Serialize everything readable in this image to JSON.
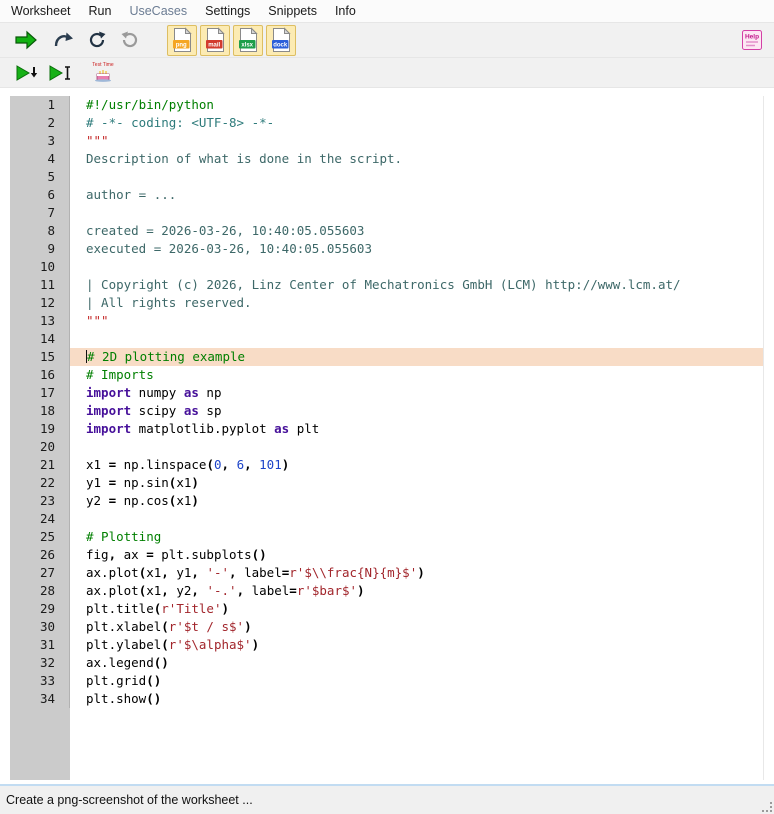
{
  "menu": {
    "items": [
      {
        "label": "Worksheet"
      },
      {
        "label": "Run"
      },
      {
        "label": "UseCases",
        "muted": true
      },
      {
        "label": "Settings"
      },
      {
        "label": "Snippets"
      },
      {
        "label": "Info"
      }
    ]
  },
  "toolbar_main": {
    "export_buttons": [
      {
        "name": "export-png",
        "label": "png",
        "color": "#F5A623"
      },
      {
        "name": "export-mail",
        "label": "mail",
        "color": "#D23B2F"
      },
      {
        "name": "export-xlsx",
        "label": "xlsx",
        "color": "#1E9E4A"
      },
      {
        "name": "export-dock",
        "label": "dock",
        "color": "#2B5FD9"
      }
    ],
    "help_label": "Help"
  },
  "toolbar_run": {
    "test_time_label": "Test Time"
  },
  "icons": {
    "run": "green-arrow-right",
    "run_reload": "curved-arrow",
    "refresh": "circular-arrow-clockwise",
    "undo": "circular-arrow-counterclockwise",
    "help": "help-box",
    "play_down": "play-with-down-arrow",
    "play_bar": "play-with-end-bar",
    "test_time": "birthday-cake",
    "grip": "resize-grip"
  },
  "colors": {
    "syn-comment": "#007F00",
    "syn-coding": "#2E7B7B",
    "syn-docstring": "#3D6868",
    "syn-docquote": "#C42B2B",
    "syn-keyword": "#46109A",
    "syn-number": "#1C43C8",
    "syn-string": "#A2262C",
    "highlight-line": "#F8DCC6",
    "gutter-bg": "#CBCBCB"
  },
  "editor": {
    "lines": [
      {
        "n": 1,
        "segs": [
          {
            "t": "#!/usr/bin/python",
            "c": "com"
          }
        ]
      },
      {
        "n": 2,
        "segs": [
          {
            "t": "# -*- coding: <UTF-8> -*-",
            "c": "cod"
          }
        ]
      },
      {
        "n": 3,
        "segs": [
          {
            "t": "\"\"\"",
            "c": "docq"
          }
        ]
      },
      {
        "n": 4,
        "segs": [
          {
            "t": "Description of what is done in the script.",
            "c": "doc"
          }
        ]
      },
      {
        "n": 5,
        "segs": []
      },
      {
        "n": 6,
        "segs": [
          {
            "t": "author = ...",
            "c": "doc"
          }
        ]
      },
      {
        "n": 7,
        "segs": []
      },
      {
        "n": 8,
        "segs": [
          {
            "t": "created = 2026-03-26, 10:40:05.055603",
            "c": "doc"
          }
        ]
      },
      {
        "n": 9,
        "segs": [
          {
            "t": "executed = 2026-03-26, 10:40:05.055603",
            "c": "doc"
          }
        ]
      },
      {
        "n": 10,
        "segs": []
      },
      {
        "n": 11,
        "segs": [
          {
            "t": "| Copyright (c) 2026, Linz Center of Mechatronics GmbH (LCM) http://www.lcm.at/",
            "c": "doc"
          }
        ]
      },
      {
        "n": 12,
        "segs": [
          {
            "t": "| All rights reserved.",
            "c": "doc"
          }
        ]
      },
      {
        "n": 13,
        "segs": [
          {
            "t": "\"\"\"",
            "c": "docq"
          }
        ]
      },
      {
        "n": 14,
        "segs": []
      },
      {
        "n": 15,
        "hl": true,
        "caret": true,
        "segs": [
          {
            "t": "# 2D plotting example",
            "c": "com"
          }
        ]
      },
      {
        "n": 16,
        "segs": [
          {
            "t": "# Imports",
            "c": "com"
          }
        ]
      },
      {
        "n": 17,
        "segs": [
          {
            "t": "import",
            "c": "kw"
          },
          {
            "t": " numpy ",
            "c": "pln"
          },
          {
            "t": "as",
            "c": "kw"
          },
          {
            "t": " np",
            "c": "pln"
          }
        ]
      },
      {
        "n": 18,
        "segs": [
          {
            "t": "import",
            "c": "kw"
          },
          {
            "t": " scipy ",
            "c": "pln"
          },
          {
            "t": "as",
            "c": "kw"
          },
          {
            "t": " sp",
            "c": "pln"
          }
        ]
      },
      {
        "n": 19,
        "segs": [
          {
            "t": "import",
            "c": "kw"
          },
          {
            "t": " matplotlib.pyplot ",
            "c": "pln"
          },
          {
            "t": "as",
            "c": "kw"
          },
          {
            "t": " plt",
            "c": "pln"
          }
        ]
      },
      {
        "n": 20,
        "segs": []
      },
      {
        "n": 21,
        "segs": [
          {
            "t": "x1 ",
            "c": "pln"
          },
          {
            "t": "= ",
            "c": "op"
          },
          {
            "t": "np.linspace",
            "c": "pln"
          },
          {
            "t": "(",
            "c": "op"
          },
          {
            "t": "0",
            "c": "num"
          },
          {
            "t": ", ",
            "c": "op"
          },
          {
            "t": "6",
            "c": "num"
          },
          {
            "t": ", ",
            "c": "op"
          },
          {
            "t": "101",
            "c": "num"
          },
          {
            "t": ")",
            "c": "op"
          }
        ]
      },
      {
        "n": 22,
        "segs": [
          {
            "t": "y1 ",
            "c": "pln"
          },
          {
            "t": "= ",
            "c": "op"
          },
          {
            "t": "np.sin",
            "c": "pln"
          },
          {
            "t": "(",
            "c": "op"
          },
          {
            "t": "x1",
            "c": "pln"
          },
          {
            "t": ")",
            "c": "op"
          }
        ]
      },
      {
        "n": 23,
        "segs": [
          {
            "t": "y2 ",
            "c": "pln"
          },
          {
            "t": "= ",
            "c": "op"
          },
          {
            "t": "np.cos",
            "c": "pln"
          },
          {
            "t": "(",
            "c": "op"
          },
          {
            "t": "x1",
            "c": "pln"
          },
          {
            "t": ")",
            "c": "op"
          }
        ]
      },
      {
        "n": 24,
        "segs": []
      },
      {
        "n": 25,
        "segs": [
          {
            "t": "# Plotting",
            "c": "com"
          }
        ]
      },
      {
        "n": 26,
        "segs": [
          {
            "t": "fig",
            "c": "pln"
          },
          {
            "t": ", ",
            "c": "op"
          },
          {
            "t": "ax ",
            "c": "pln"
          },
          {
            "t": "= ",
            "c": "op"
          },
          {
            "t": "plt.subplots",
            "c": "pln"
          },
          {
            "t": "()",
            "c": "op"
          }
        ]
      },
      {
        "n": 27,
        "segs": [
          {
            "t": "ax.plot",
            "c": "pln"
          },
          {
            "t": "(",
            "c": "op"
          },
          {
            "t": "x1",
            "c": "pln"
          },
          {
            "t": ", ",
            "c": "op"
          },
          {
            "t": "y1",
            "c": "pln"
          },
          {
            "t": ", ",
            "c": "op"
          },
          {
            "t": "'-'",
            "c": "str"
          },
          {
            "t": ", ",
            "c": "op"
          },
          {
            "t": "label",
            "c": "pln"
          },
          {
            "t": "=",
            "c": "op"
          },
          {
            "t": "r'$\\\\frac{N}{m}$'",
            "c": "str"
          },
          {
            "t": ")",
            "c": "op"
          }
        ]
      },
      {
        "n": 28,
        "segs": [
          {
            "t": "ax.plot",
            "c": "pln"
          },
          {
            "t": "(",
            "c": "op"
          },
          {
            "t": "x1",
            "c": "pln"
          },
          {
            "t": ", ",
            "c": "op"
          },
          {
            "t": "y2",
            "c": "pln"
          },
          {
            "t": ", ",
            "c": "op"
          },
          {
            "t": "'-.'",
            "c": "str"
          },
          {
            "t": ", ",
            "c": "op"
          },
          {
            "t": "label",
            "c": "pln"
          },
          {
            "t": "=",
            "c": "op"
          },
          {
            "t": "r'$bar$'",
            "c": "str"
          },
          {
            "t": ")",
            "c": "op"
          }
        ]
      },
      {
        "n": 29,
        "segs": [
          {
            "t": "plt.title",
            "c": "pln"
          },
          {
            "t": "(",
            "c": "op"
          },
          {
            "t": "r'Title'",
            "c": "str"
          },
          {
            "t": ")",
            "c": "op"
          }
        ]
      },
      {
        "n": 30,
        "segs": [
          {
            "t": "plt.xlabel",
            "c": "pln"
          },
          {
            "t": "(",
            "c": "op"
          },
          {
            "t": "r'$t / s$'",
            "c": "str"
          },
          {
            "t": ")",
            "c": "op"
          }
        ]
      },
      {
        "n": 31,
        "segs": [
          {
            "t": "plt.ylabel",
            "c": "pln"
          },
          {
            "t": "(",
            "c": "op"
          },
          {
            "t": "r'$\\alpha$'",
            "c": "str"
          },
          {
            "t": ")",
            "c": "op"
          }
        ]
      },
      {
        "n": 32,
        "segs": [
          {
            "t": "ax.legend",
            "c": "pln"
          },
          {
            "t": "()",
            "c": "op"
          }
        ]
      },
      {
        "n": 33,
        "segs": [
          {
            "t": "plt.grid",
            "c": "pln"
          },
          {
            "t": "()",
            "c": "op"
          }
        ]
      },
      {
        "n": 34,
        "segs": [
          {
            "t": "plt.show",
            "c": "pln"
          },
          {
            "t": "()",
            "c": "op"
          }
        ]
      }
    ]
  },
  "statusbar": {
    "text": "Create a png-screenshot of the worksheet ..."
  }
}
